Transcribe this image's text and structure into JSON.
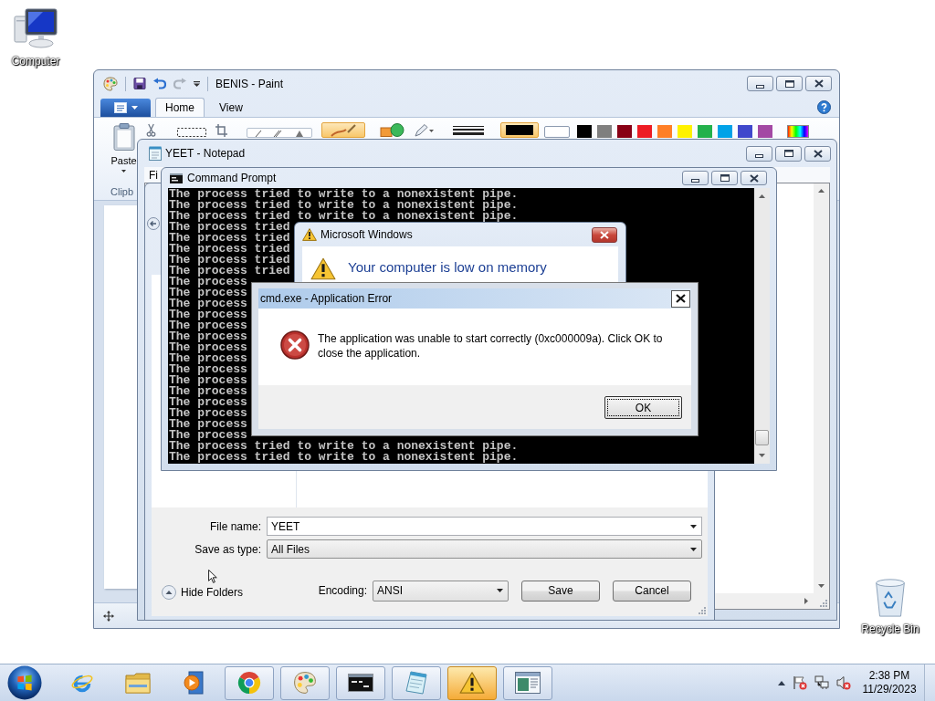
{
  "desktop": {
    "icons": [
      {
        "kind": "computer",
        "label": "Computer"
      },
      {
        "kind": "recycle_bin",
        "label": "Recycle Bin"
      }
    ]
  },
  "paint": {
    "title": "BENIS - Paint",
    "quick_access": [
      {
        "kind": "save",
        "disabled": false
      },
      {
        "kind": "undo",
        "disabled": false
      },
      {
        "kind": "redo",
        "disabled": true
      }
    ],
    "tabs": [
      {
        "label": "Home",
        "selected": true
      },
      {
        "label": "View",
        "selected": false
      }
    ],
    "paste_label": "Paste",
    "clipboard_group_label": "Clipb",
    "tools": [
      {
        "kind": "cut",
        "selected": false
      },
      {
        "kind": "select",
        "selected": false
      },
      {
        "kind": "crop",
        "selected": false
      },
      {
        "kind": "gallery",
        "selected": false
      },
      {
        "kind": "brush",
        "selected": true
      },
      {
        "kind": "shapes",
        "selected": false
      },
      {
        "kind": "pencil",
        "selected": false
      },
      {
        "kind": "size",
        "selected": false
      }
    ],
    "active_colors": [
      {
        "color": "#000000",
        "selected": true
      },
      {
        "color": "#ffffff",
        "selected": false
      }
    ],
    "palette": [
      {
        "color": "#000000"
      },
      {
        "color": "#7f7f7f"
      },
      {
        "color": "#880015"
      },
      {
        "color": "#ed1c24"
      },
      {
        "color": "#ff7f27"
      },
      {
        "color": "#fff200"
      },
      {
        "color": "#22b14c"
      },
      {
        "color": "#00a2e8"
      },
      {
        "color": "#3f48cc"
      },
      {
        "color": "#a349a4"
      }
    ]
  },
  "notepad": {
    "title": "YEET - Notepad",
    "menu": [
      "Fi"
    ]
  },
  "save_dialog": {
    "fields": [
      {
        "kind": "combo",
        "label": "File name:",
        "value": "YEET"
      },
      {
        "kind": "select",
        "label": "Save as type:",
        "value": "All Files"
      }
    ],
    "hide_folders": "Hide Folders",
    "encoding": {
      "label": "Encoding:",
      "value": "ANSI"
    },
    "buttons": [
      "Save",
      "Cancel"
    ]
  },
  "command_prompt": {
    "title": "Command Prompt",
    "lines": [
      "The process tried to write to a nonexistent pipe.",
      "The process tried to write to a nonexistent pipe.",
      "The process tried to write to a nonexistent pipe.",
      "The process tried",
      "The process tried",
      "The process tried",
      "The process tried",
      "The process tried",
      "The process",
      "The process",
      "The process",
      "The process",
      "The process",
      "The process",
      "The process",
      "The process",
      "The process",
      "The process",
      "The process",
      "The process",
      "The process",
      "The process",
      "The process",
      "The process tried to write to a nonexistent pipe.",
      "The process tried to write to a nonexistent pipe."
    ]
  },
  "memory_dialog": {
    "title": "Microsoft Windows",
    "heading": "Your computer is low on memory"
  },
  "error_dialog": {
    "title": "cmd.exe - Application Error",
    "message": "The application was unable to start correctly (0xc000009a). Click OK to close the application.",
    "button": "OK"
  },
  "taskbar": {
    "apps": [
      {
        "kind": "ie",
        "running": false,
        "flashing": false
      },
      {
        "kind": "explorer",
        "running": false,
        "flashing": false
      },
      {
        "kind": "media_player",
        "running": false,
        "flashing": false
      },
      {
        "kind": "chrome",
        "running": true,
        "flashing": false
      },
      {
        "kind": "paint",
        "running": true,
        "flashing": false
      },
      {
        "kind": "console",
        "running": true,
        "flashing": false
      },
      {
        "kind": "notepad",
        "running": true,
        "flashing": false
      },
      {
        "kind": "warning",
        "running": true,
        "flashing": true
      },
      {
        "kind": "window",
        "running": true,
        "flashing": false
      }
    ],
    "tray": [
      {
        "kind": "show_hidden"
      },
      {
        "kind": "action_center"
      },
      {
        "kind": "network"
      },
      {
        "kind": "volume_muted"
      }
    ],
    "clock": {
      "time": "2:38 PM",
      "date": "11/29/2023"
    }
  }
}
